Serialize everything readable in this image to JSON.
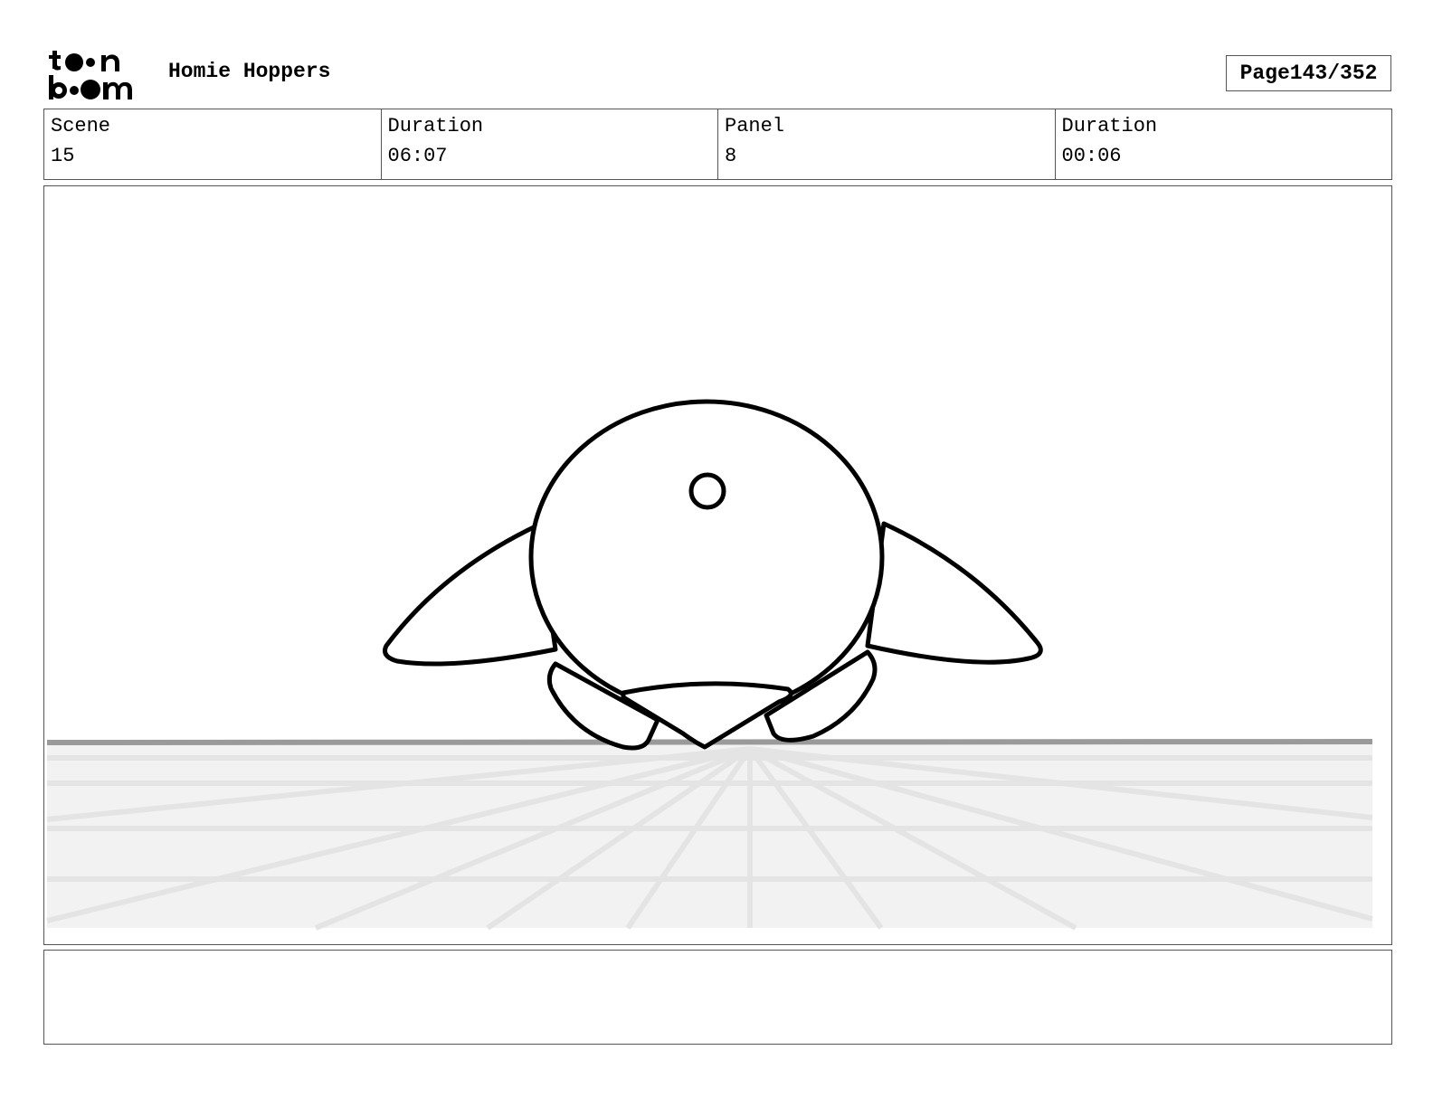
{
  "header": {
    "logo": {
      "line1": "toon",
      "line2": "boom"
    },
    "project_title": "Homie Hoppers",
    "page_label": "Page",
    "page_current": "143",
    "page_total": "352"
  },
  "info": [
    {
      "label": "Scene",
      "value": "15"
    },
    {
      "label": "Duration",
      "value": "06:07"
    },
    {
      "label": "Panel",
      "value": "8"
    },
    {
      "label": "Duration",
      "value": "00:06"
    }
  ],
  "panel": {
    "colors": {
      "ink": "#000000",
      "floor": "#f2f2f2",
      "horizon": "#9a9a9a",
      "grid": "#e4e4e4"
    }
  },
  "notes": {
    "text": ""
  }
}
